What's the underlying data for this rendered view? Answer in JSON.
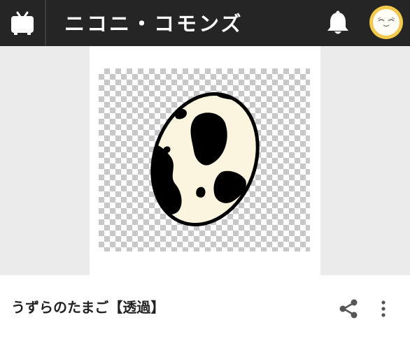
{
  "header": {
    "logo_text": "ニコニ・コモンズ",
    "home_icon": "tv-icon",
    "bell_icon": "bell-icon",
    "avatar_icon": "user-avatar-icon"
  },
  "preview": {
    "image_name": "egg-image",
    "background": "transparent-checkerboard"
  },
  "content": {
    "title": "うずらのたまご【透過】",
    "share_icon": "share-icon",
    "more_icon": "more-vertical-icon"
  },
  "colors": {
    "header_bg": "#252525",
    "page_bg": "#ebebeb",
    "avatar_ring": "#f2c94c"
  }
}
